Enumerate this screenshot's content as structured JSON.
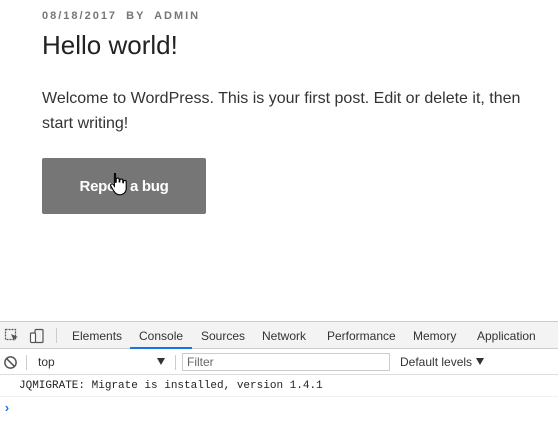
{
  "post": {
    "date": "08/18/2017",
    "by": "BY",
    "author": "ADMIN",
    "title": "Hello world!",
    "body": "Welcome to WordPress. This is your first post. Edit or delete it, then start writing!",
    "button_label": "Report a bug"
  },
  "devtools": {
    "icons": [
      "inspect-element-icon",
      "device-toolbar-icon",
      "clear-console-icon"
    ],
    "tabs": [
      "Elements",
      "Console",
      "Sources",
      "Network",
      "Performance",
      "Memory",
      "Application"
    ],
    "active_tab": "Console",
    "context": "top",
    "filter_placeholder": "Filter",
    "levels_label": "Default levels",
    "messages": [
      "JQMIGRATE: Migrate is installed, version 1.4.1"
    ],
    "prompt": "›",
    "accent_color": "#1a73e8"
  }
}
